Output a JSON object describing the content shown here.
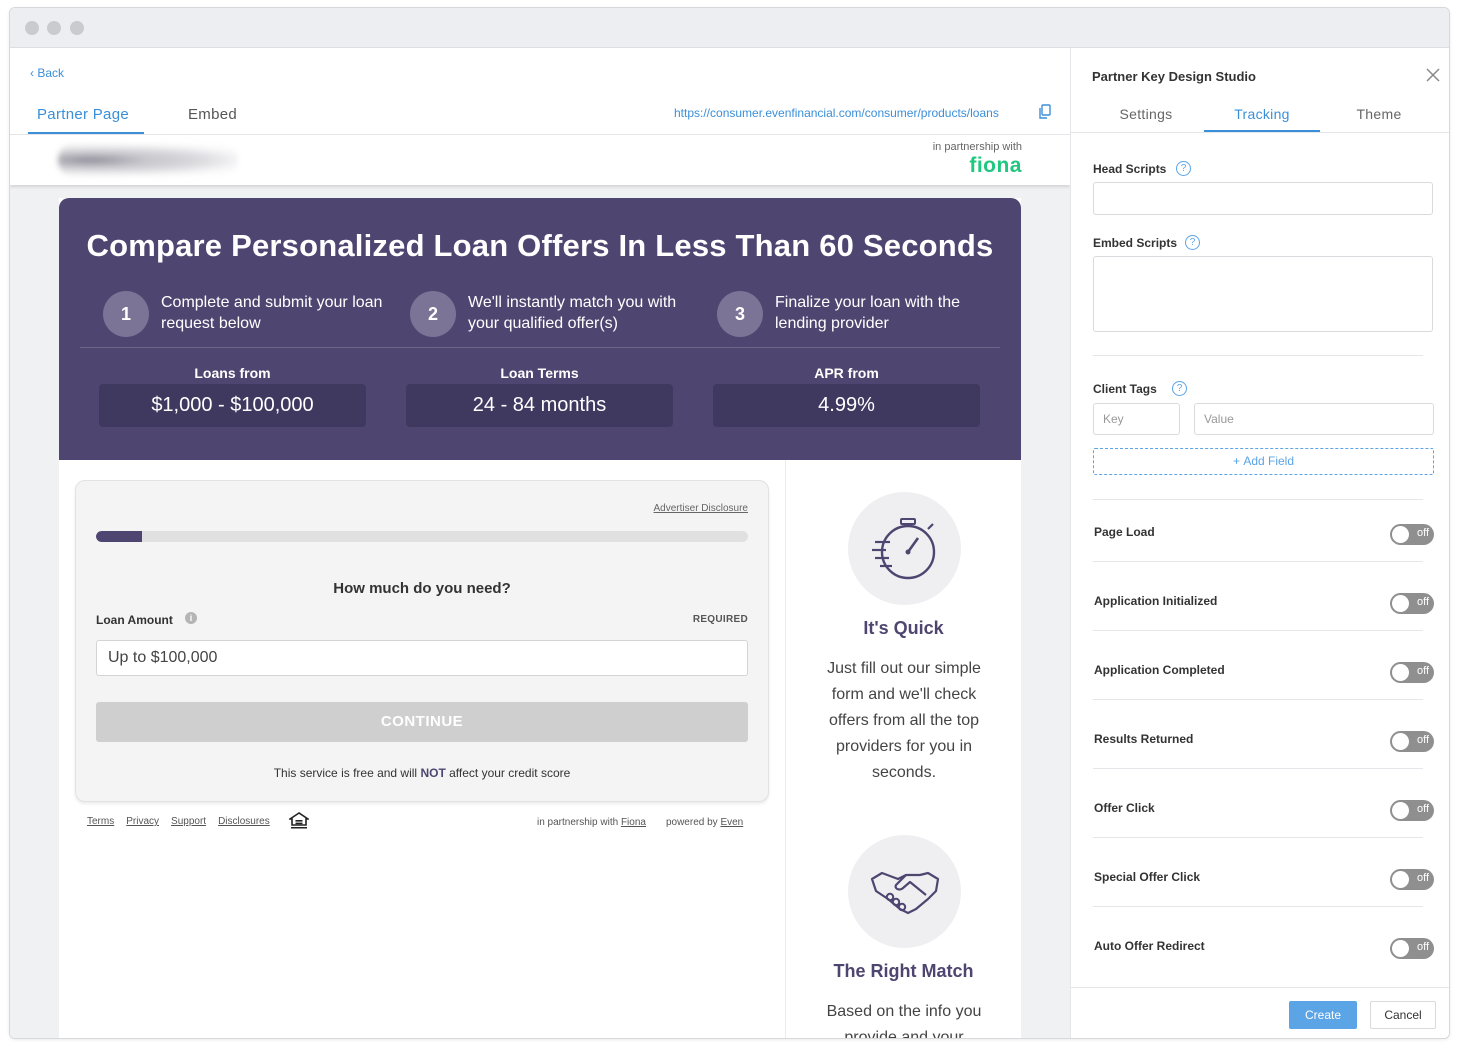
{
  "nav": {
    "back_label": "Back",
    "tabs": [
      {
        "label": "Partner Page",
        "active": true
      },
      {
        "label": "Embed",
        "active": false
      }
    ],
    "url": "https://consumer.evenfinancial.com/consumer/products/loans"
  },
  "preview": {
    "partnership_text": "in partnership with",
    "partner_logo": "fiona",
    "hero": {
      "title": "Compare Personalized Loan Offers In Less Than 60 Seconds",
      "steps": [
        {
          "num": "1",
          "text": "Complete and submit your loan request below"
        },
        {
          "num": "2",
          "text": "We'll instantly match you with your qualified offer(s)"
        },
        {
          "num": "3",
          "text": "Finalize your loan with the lending provider"
        }
      ],
      "stats": [
        {
          "label": "Loans from",
          "value": "$1,000 - $100,000"
        },
        {
          "label": "Loan Terms",
          "value": "24 - 84 months"
        },
        {
          "label": "APR from",
          "value": "4.99%"
        }
      ]
    },
    "form": {
      "advertiser_disclosure": "Advertiser Disclosure",
      "progress_fraction": 0.07,
      "question": "How much do you need?",
      "loan_label": "Loan Amount",
      "required_label": "REQUIRED",
      "loan_placeholder": "Up to $100,000",
      "continue_label": "CONTINUE",
      "note_before": "This service is free and will ",
      "note_bold": "NOT",
      "note_after": " affect your credit score"
    },
    "footer": {
      "links": [
        "Terms",
        "Privacy",
        "Support",
        "Disclosures"
      ],
      "partnership_prefix": "in partnership with ",
      "partnership_name": "Fiona",
      "powered_prefix": "powered by ",
      "powered_name": "Even"
    },
    "features": [
      {
        "icon": "stopwatch-icon",
        "title": "It's Quick",
        "text": "Just fill out our simple form and we'll check offers from all the top providers for you in seconds."
      },
      {
        "icon": "handshake-icon",
        "title": "The Right Match",
        "text": "Based on the info you provide and your"
      }
    ]
  },
  "panel": {
    "title": "Partner Key Design Studio",
    "tabs": [
      {
        "label": "Settings",
        "active": false
      },
      {
        "label": "Tracking",
        "active": true
      },
      {
        "label": "Theme",
        "active": false
      }
    ],
    "head_scripts_label": "Head Scripts",
    "embed_scripts_label": "Embed Scripts",
    "client_tags_label": "Client Tags",
    "key_placeholder": "Key",
    "value_placeholder": "Value",
    "add_field_label": "Add Field",
    "toggles": [
      {
        "label": "Page Load",
        "state": "off"
      },
      {
        "label": "Application Initialized",
        "state": "off"
      },
      {
        "label": "Application Completed",
        "state": "off"
      },
      {
        "label": "Results Returned",
        "state": "off"
      },
      {
        "label": "Offer Click",
        "state": "off"
      },
      {
        "label": "Special Offer Click",
        "state": "off"
      },
      {
        "label": "Auto Offer Redirect",
        "state": "off"
      }
    ],
    "create_label": "Create",
    "cancel_label": "Cancel"
  },
  "colors": {
    "accent": "#3b8fd8",
    "hero_purple": "#4e4670",
    "fiona_green": "#1fc77f"
  }
}
